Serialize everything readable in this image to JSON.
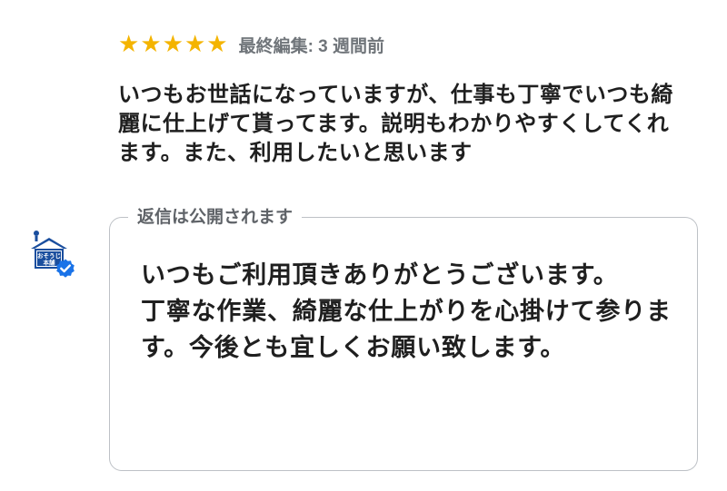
{
  "review": {
    "stars": [
      "★",
      "★",
      "★",
      "★",
      "★"
    ],
    "star_color": "#f4b400",
    "meta": "最終編集: 3 週間前",
    "text": "いつもお世話になっていますが、仕事も丁寧でいつも綺麗に仕上げて貰ってます。説明もわかりやすくしてくれます。また、利用したいと思います"
  },
  "owner": {
    "avatar_icon": "house-logo-icon",
    "avatar_text": "おそうじ本舗",
    "verified_icon": "verified-badge-icon",
    "verified_color": "#1a73e8"
  },
  "reply": {
    "legend": "返信は公開されます",
    "text": "いつもご利用頂きありがとうございます。\n丁寧な作業、綺麗な仕上がりを心掛けて参ります。今後とも宜しくお願い致します。"
  }
}
